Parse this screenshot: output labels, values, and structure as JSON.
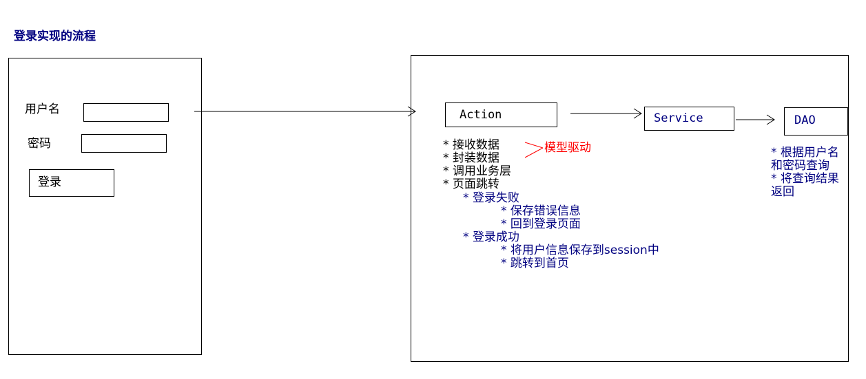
{
  "title": "登录实现的流程",
  "login_form": {
    "username_label": "用户名",
    "password_label": "密码",
    "login_button": "登录"
  },
  "action": {
    "label": "Action",
    "items": [
      "* 接收数据",
      "* 封装数据",
      "* 调用业务层",
      "* 页面跳转"
    ],
    "annotation": "模型驱动",
    "fail": {
      "label": "* 登录失败",
      "items": [
        "* 保存错误信息",
        "* 回到登录页面"
      ]
    },
    "success": {
      "label": "* 登录成功",
      "items": [
        "* 将用户信息保存到session中",
        "* 跳转到首页"
      ]
    }
  },
  "service": {
    "label": "Service"
  },
  "dao": {
    "label": "DAO",
    "notes": [
      "* 根据用户名",
      "和密码查询",
      "* 将查询结果",
      "返回"
    ]
  },
  "colors": {
    "navy": "#000080",
    "black": "#000000",
    "red": "#ff0000"
  }
}
